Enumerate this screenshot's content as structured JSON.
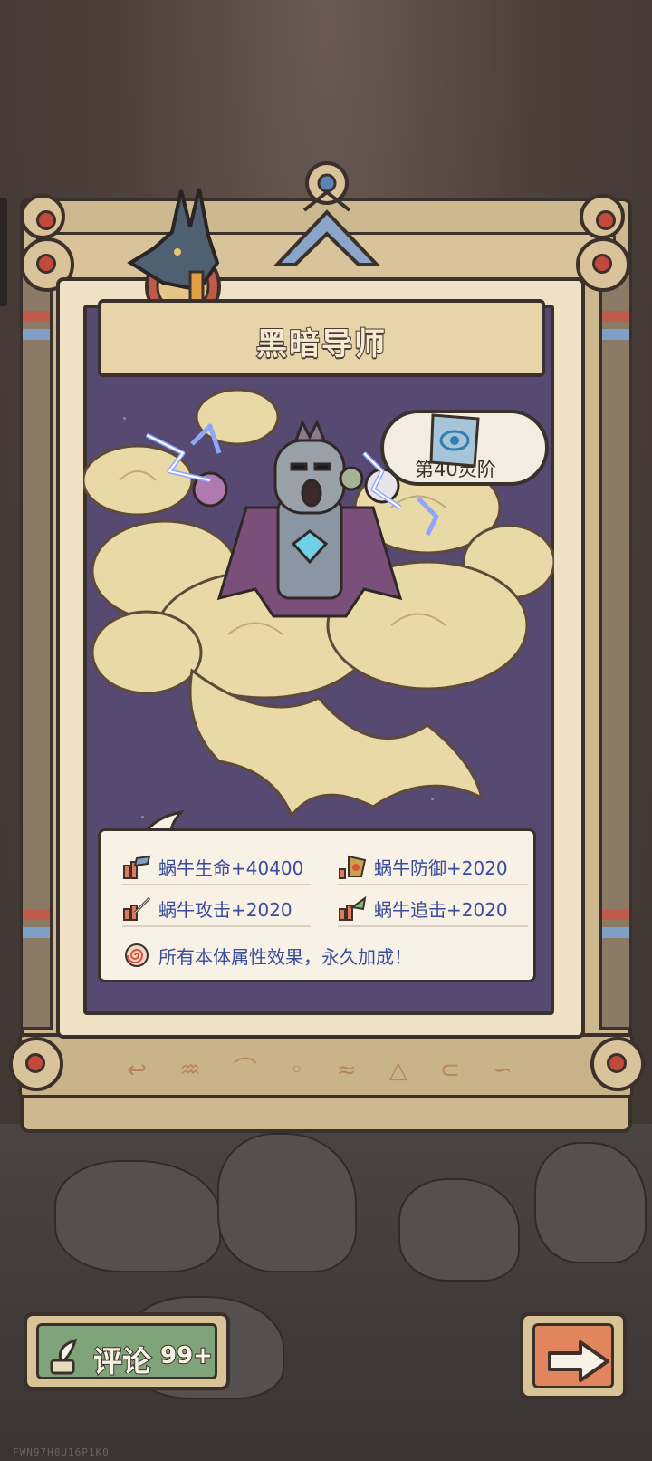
{
  "dialog": {
    "title": "黑暗导师",
    "level_label": "第40灵阶"
  },
  "stats": [
    {
      "label": "蜗牛生命+40400",
      "icon": "health-icon"
    },
    {
      "label": "蜗牛防御+2020",
      "icon": "defense-icon"
    },
    {
      "label": "蜗牛攻击+2020",
      "icon": "attack-icon"
    },
    {
      "label": "蜗牛追击+2020",
      "icon": "pursuit-icon"
    }
  ],
  "effect_note": "所有本体属性效果，永久加成！",
  "bottom_bar": {
    "comment_label": "评论",
    "comment_count": "99+"
  },
  "watermark": "FWN97H0U16P1K0",
  "colors": {
    "panel": "#564a72",
    "frame": "#cdb98f",
    "stat_text": "#3a4c9a",
    "comment_button": "#7fa47a",
    "next_button": "#e0855e"
  }
}
